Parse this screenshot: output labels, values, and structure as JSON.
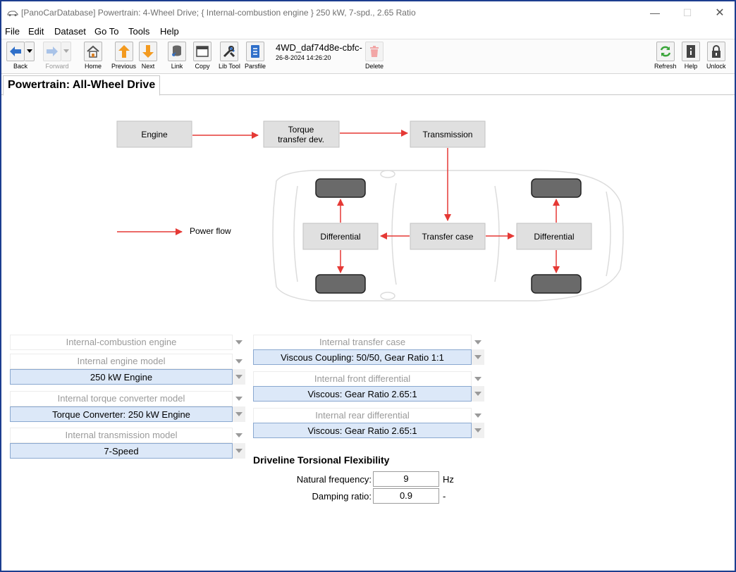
{
  "window": {
    "title": "[PanoCarDatabase] Powertrain: 4-Wheel Drive; { Internal-combustion engine } 250 kW, 7-spd., 2.65 Ratio",
    "controls": [
      "—",
      "☐",
      "✕"
    ]
  },
  "menu": [
    "File",
    "Edit",
    "Dataset",
    "Go To",
    "Tools",
    "Help"
  ],
  "toolbar": {
    "back": "Back",
    "forward": "Forward",
    "home": "Home",
    "previous": "Previous",
    "next": "Next",
    "link": "Link",
    "copy": "Copy",
    "lib_tool": "Lib Tool",
    "parsfile": "Parsfile",
    "dataset_name": "4WD_daf74d8e-cbfc-",
    "dataset_date": "26-8-2024 14:26:20",
    "delete": "Delete",
    "refresh": "Refresh",
    "help": "Help",
    "unlock": "Unlock"
  },
  "tab": {
    "label": "Powertrain: All-Wheel Drive"
  },
  "diagram": {
    "engine": "Engine",
    "torque_1": "Torque",
    "torque_2": "transfer dev.",
    "transmission": "Transmission",
    "transfer_case": "Transfer case",
    "diff_left": "Differential",
    "diff_right": "Differential",
    "legend": "Power flow",
    "colors": {
      "arrow": "#e53935",
      "box": "#e0e0e0",
      "tire": "#6a6a6a"
    }
  },
  "left_panel": {
    "engine_type_label": "Internal-combustion engine",
    "engine_model_label": "Internal engine model",
    "engine_model_value": "250 kW Engine",
    "torque_label": "Internal torque converter model",
    "torque_value": "Torque Converter: 250 kW Engine",
    "transmission_label": "Internal transmission model",
    "transmission_value": "7-Speed"
  },
  "right_panel": {
    "transfer_label": "Internal transfer case",
    "transfer_value": "Viscous Coupling: 50/50, Gear Ratio 1:1",
    "front_diff_label": "Internal front differential",
    "front_diff_value": "Viscous: Gear Ratio 2.65:1",
    "rear_diff_label": "Internal rear differential",
    "rear_diff_value": "Viscous: Gear Ratio 2.65:1"
  },
  "driveline": {
    "title": "Driveline Torsional Flexibility",
    "freq_label": "Natural frequency:",
    "freq_value": "9",
    "freq_unit": "Hz",
    "damp_label": "Damping ratio:",
    "damp_value": "0.9",
    "damp_unit": "-"
  }
}
